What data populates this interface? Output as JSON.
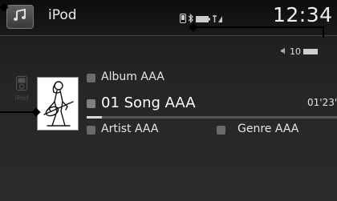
{
  "header": {
    "source_title": "iPod",
    "clock": "12:34",
    "source_icon": "music-note-icon",
    "status_icons": [
      "phone-icon",
      "bluetooth-icon",
      "battery-icon",
      "signal-icon"
    ]
  },
  "volume": {
    "level": "10",
    "icon": "speaker-icon"
  },
  "side": {
    "label": "iPod",
    "icon": "ipod-icon"
  },
  "track": {
    "album": "Album AAA",
    "song": "01 Song AAA",
    "elapsed": "01'23\"",
    "artist": "Artist AAA",
    "genre": "Genre AAA",
    "progress": 0.06
  },
  "colors": {
    "screen_bg": "#262626",
    "text": "#e6e6e6"
  }
}
